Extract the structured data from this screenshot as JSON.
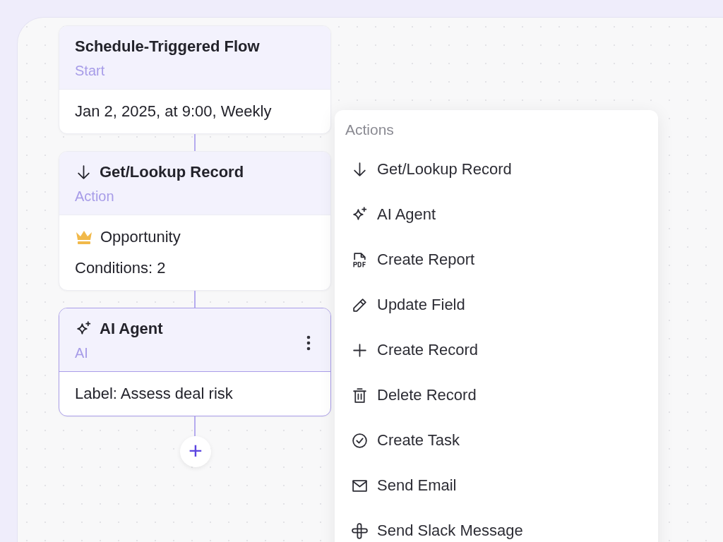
{
  "nodes": [
    {
      "kind": "start",
      "title": "Schedule-Triggered Flow",
      "type": "Start",
      "selected": false,
      "lines": [
        {
          "kind": "text",
          "text": "Jan 2, 2025, at 9:00, Weekly"
        }
      ]
    },
    {
      "kind": "lookup",
      "title": "Get/Lookup Record",
      "type": "Action",
      "selected": false,
      "lines": [
        {
          "kind": "object",
          "text": "Opportunity"
        },
        {
          "kind": "text",
          "text": "Conditions: 2"
        }
      ]
    },
    {
      "kind": "ai",
      "title": "AI Agent",
      "type": "AI",
      "selected": true,
      "lines": [
        {
          "kind": "text",
          "text": "Label: Assess deal risk"
        }
      ]
    }
  ],
  "add_button": "+",
  "menu": {
    "title": "Actions",
    "items": [
      {
        "kind": "lookup",
        "label": "Get/Lookup Record"
      },
      {
        "kind": "ai",
        "label": "AI Agent"
      },
      {
        "kind": "report",
        "label": "Create Report"
      },
      {
        "kind": "update",
        "label": "Update Field"
      },
      {
        "kind": "create",
        "label": "Create Record"
      },
      {
        "kind": "delete",
        "label": "Delete Record"
      },
      {
        "kind": "task",
        "label": "Create Task"
      },
      {
        "kind": "email",
        "label": "Send Email"
      },
      {
        "kind": "slack",
        "label": "Send Slack Message"
      }
    ]
  }
}
